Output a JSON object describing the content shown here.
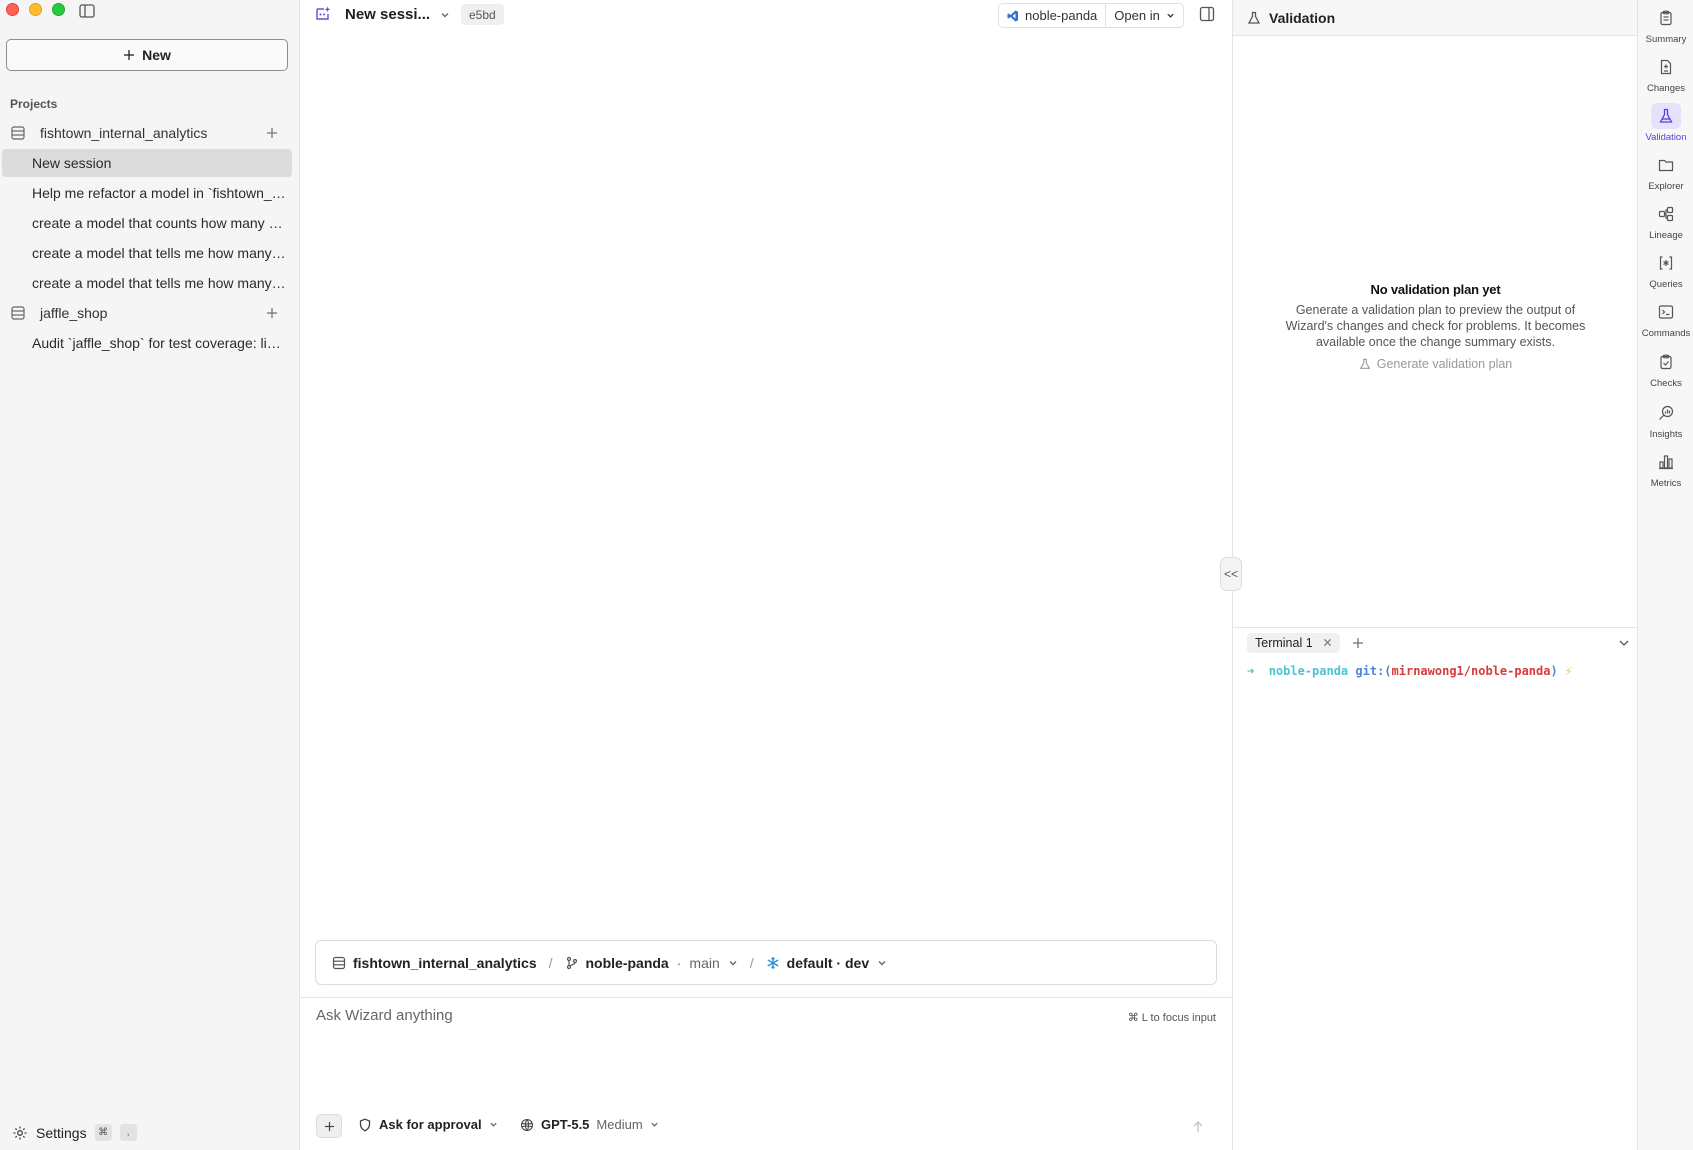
{
  "sidebar": {
    "new_label": "New",
    "projects_label": "Projects",
    "projects": [
      {
        "name": "fishtown_internal_analytics",
        "sessions": [
          "New session",
          "Help me refactor a model in `fishtown_internal_analytics`",
          "create a model that counts how many new users",
          "create a model that tells me how many users",
          "create a model that tells me how many orders"
        ]
      },
      {
        "name": "jaffle_shop",
        "sessions": [
          "Audit `jaffle_shop` for test coverage: list models without tests"
        ]
      }
    ],
    "settings_label": "Settings",
    "settings_shortcut": [
      "⌘",
      ","
    ]
  },
  "main": {
    "session_title": "New sessi...",
    "session_hash": "e5bd",
    "env_name": "noble-panda",
    "open_in_label": "Open in",
    "context": {
      "project": "fishtown_internal_analytics",
      "worktree": "noble-panda",
      "branch": "main",
      "target": "default · dev"
    },
    "composer": {
      "placeholder": "Ask Wizard anything",
      "focus_hint": "⌘ L to focus input",
      "approval_mode": "Ask for approval",
      "model": "GPT-5.5",
      "effort": "Medium"
    },
    "collapse_glyph": "<<"
  },
  "right_panel": {
    "title": "Validation",
    "empty_title": "No validation plan yet",
    "empty_desc": "Generate a validation plan to preview the output of Wizard's changes and check for problems. It becomes available once the change summary exists.",
    "generate_label": "Generate validation plan",
    "terminal": {
      "tab_label": "Terminal 1",
      "prompt_arrow": "➜",
      "prompt_host": "noble-panda",
      "prompt_git": "git:(",
      "prompt_branch": "mirnawong1/noble-panda",
      "prompt_close": ")",
      "prompt_bolt": "⚡"
    }
  },
  "rail": [
    {
      "label": "Summary",
      "icon": "clipboard-icon",
      "active": false
    },
    {
      "label": "Changes",
      "icon": "file-diff-icon",
      "active": false
    },
    {
      "label": "Validation",
      "icon": "flask-icon",
      "active": true
    },
    {
      "label": "Explorer",
      "icon": "folder-icon",
      "active": false
    },
    {
      "label": "Lineage",
      "icon": "lineage-icon",
      "active": false
    },
    {
      "label": "Queries",
      "icon": "query-icon",
      "active": false
    },
    {
      "label": "Commands",
      "icon": "terminal-icon",
      "active": false
    },
    {
      "label": "Checks",
      "icon": "clipboard-check-icon",
      "active": false
    },
    {
      "label": "Insights",
      "icon": "insights-icon",
      "active": false
    },
    {
      "label": "Metrics",
      "icon": "bar-chart-icon",
      "active": false
    }
  ],
  "colors": {
    "accent": "#5b3fd9",
    "active_session_bg": "#dcdcdc",
    "terminal_host": "#49c5d0",
    "terminal_branch": "#d93a3a"
  }
}
